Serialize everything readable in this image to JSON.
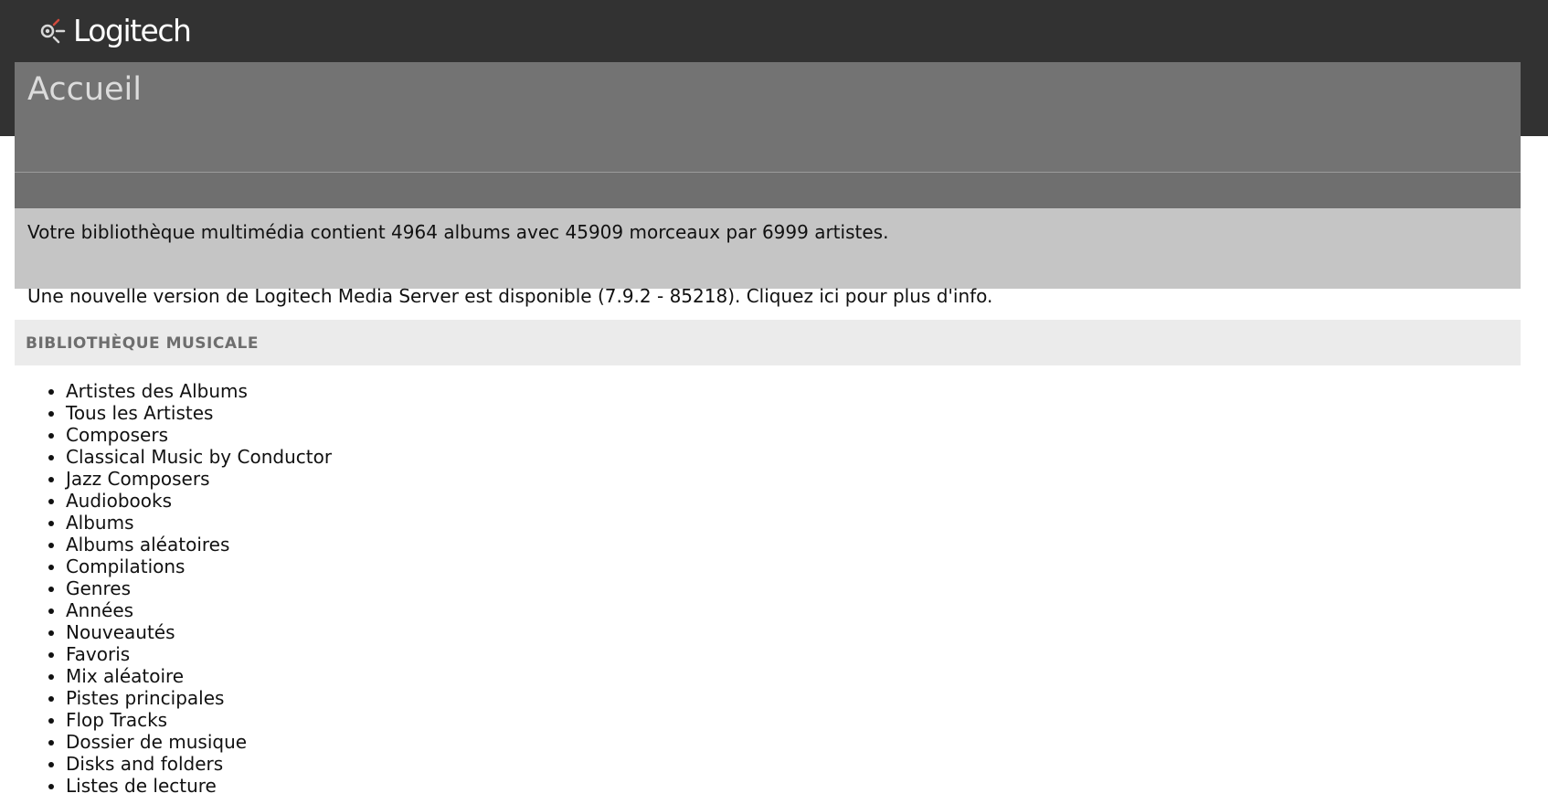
{
  "header": {
    "logo_text": "Logitech"
  },
  "page": {
    "title": "Accueil"
  },
  "library_stats": "Votre bibliothèque multimédia contient 4964 albums avec 45909 morceaux par 6999 artistes.",
  "update": {
    "text": "Une nouvelle version de Logitech Media Server est disponible (7.9.2 - 85218).",
    "link": "Cliquez ici pour plus d'info."
  },
  "music_library": {
    "title": "BIBLIOTHÈQUE MUSICALE",
    "items": [
      {
        "label": "Artistes des Albums"
      },
      {
        "label": "Tous les Artistes"
      },
      {
        "label": "Composers"
      },
      {
        "label": "Classical Music by Conductor"
      },
      {
        "label": "Jazz Composers"
      },
      {
        "label": "Audiobooks"
      },
      {
        "label": "Albums"
      },
      {
        "label": "Albums aléatoires"
      },
      {
        "label": "Compilations"
      },
      {
        "label": "Genres"
      },
      {
        "label": "Années"
      },
      {
        "label": "Nouveautés"
      },
      {
        "label": "Favoris"
      },
      {
        "label": "Mix aléatoire"
      },
      {
        "label": "Pistes principales"
      },
      {
        "label": "Flop Tracks"
      },
      {
        "label": "Dossier de musique"
      },
      {
        "label": "Disks and folders"
      },
      {
        "label": "Listes de lecture"
      }
    ]
  },
  "icons": {
    "logo": "logitech-logo-icon"
  },
  "colors": {
    "topbar": "#323232",
    "title_panel": "#737373",
    "stats_panel": "#c5c5c5",
    "section_header": "#ebebeb",
    "logo_accent": "#3aa39a",
    "logo_red": "#d04a3c"
  }
}
